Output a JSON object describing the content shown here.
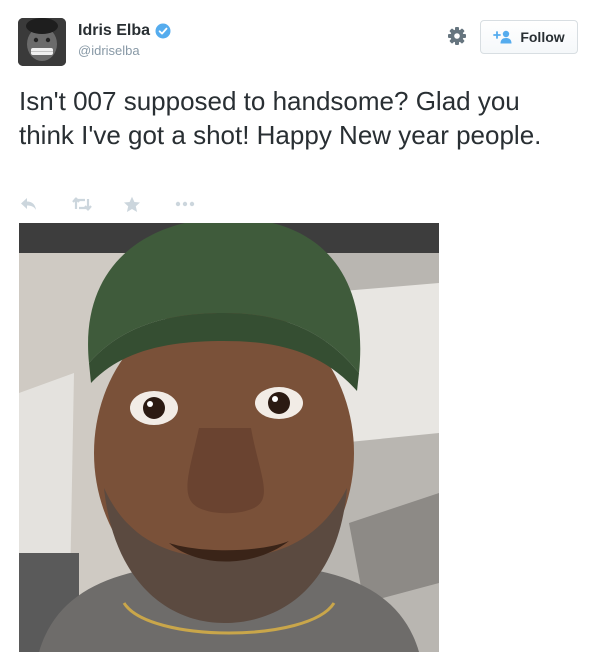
{
  "author": {
    "name": "Idris Elba",
    "handle": "@idriselba",
    "verified": true
  },
  "header": {
    "follow_label": "Follow",
    "settings_icon": "gear-icon",
    "follow_icon": "add-user-icon"
  },
  "tweet": {
    "text": "Isn't 007 supposed to handsome? Glad you think I've got a shot!  Happy New year people."
  },
  "actions": [
    {
      "icon": "reply-icon"
    },
    {
      "icon": "retweet-icon"
    },
    {
      "icon": "favorite-star-icon"
    },
    {
      "icon": "more-dots-icon"
    }
  ],
  "colors": {
    "text": "#292f33",
    "muted": "#8899a6",
    "verified_blue": "#55acee",
    "action_grey": "#ccd6dd"
  }
}
